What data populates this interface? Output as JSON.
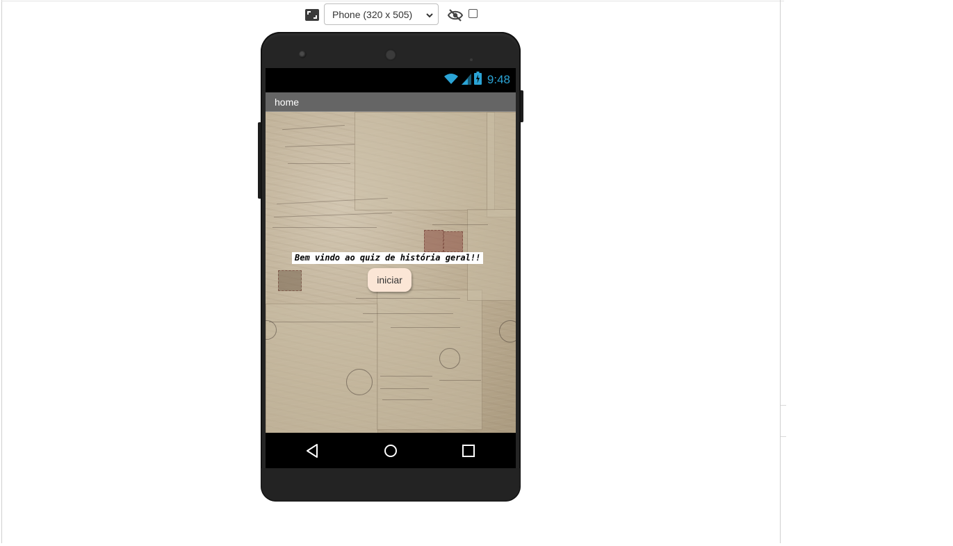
{
  "toolbar": {
    "device_select": "Phone (320 x 505)",
    "icons": {
      "resize": "fullscreen-icon",
      "hide": "eye-off-icon",
      "chevron": "chevron-down-icon"
    }
  },
  "phone": {
    "status_bar": {
      "time": "9:48",
      "icons": [
        "wifi-icon",
        "signal-icon",
        "battery-icon"
      ]
    },
    "app_bar": {
      "title": "home"
    },
    "screen": {
      "welcome_text": "Bem vindo ao quiz de história geral!!",
      "start_button": "iniciar"
    },
    "nav_bar": {
      "icons": [
        "back-icon",
        "home-icon",
        "recents-icon"
      ]
    }
  },
  "colors": {
    "app_bar": "#656565",
    "clock": "#2ba4d6",
    "button_bg": "#fbe6d6",
    "phone_body": "#252525"
  }
}
